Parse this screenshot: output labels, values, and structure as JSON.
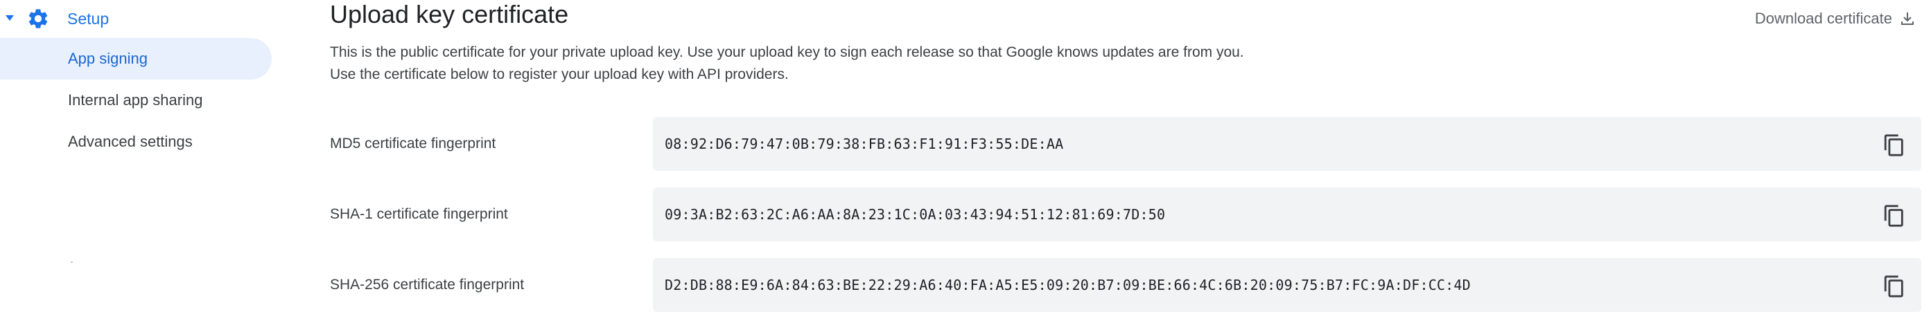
{
  "sidebar": {
    "setup_label": "Setup",
    "items": [
      {
        "label": "App signing",
        "active": true
      },
      {
        "label": "Internal app sharing",
        "active": false
      },
      {
        "label": "Advanced settings",
        "active": false
      }
    ]
  },
  "main": {
    "title": "Upload key certificate",
    "description": "This is the public certificate for your private upload key. Use your upload key to sign each release so that Google knows updates are from you. Use the certificate below to register your upload key with API providers.",
    "download_label": "Download certificate",
    "fingerprints": [
      {
        "label": "MD5 certificate fingerprint",
        "value": "08:92:D6:79:47:0B:79:38:FB:63:F1:91:F3:55:DE:AA"
      },
      {
        "label": "SHA-1 certificate fingerprint",
        "value": "09:3A:B2:63:2C:A6:AA:8A:23:1C:0A:03:43:94:51:12:81:69:7D:50"
      },
      {
        "label": "SHA-256 certificate fingerprint",
        "value": "D2:DB:88:E9:6A:84:63:BE:22:29:A6:40:FA:A5:E5:09:20:B7:09:BE:66:4C:6B:20:09:75:B7:FC:9A:DF:CC:4D"
      }
    ]
  },
  "colors": {
    "accent": "#1a73e8",
    "active_bg": "#e8f0fe",
    "field_bg": "#f1f3f4",
    "muted_text": "#5f6368"
  },
  "icons": {
    "caret": "caret-down-icon",
    "setup": "gear-icon",
    "download": "download-icon",
    "copy": "copy-icon"
  }
}
